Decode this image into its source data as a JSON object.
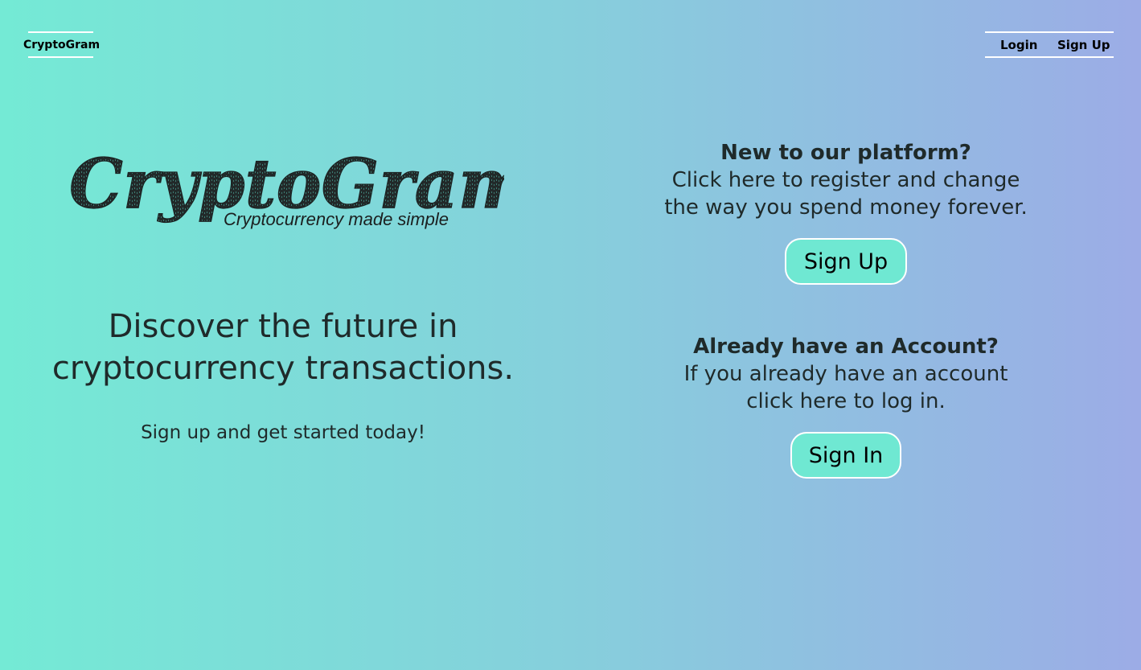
{
  "navbar": {
    "brand": "CryptoGram",
    "login_label": "Login",
    "signup_label": "Sign Up"
  },
  "logo": {
    "wordmark": "CryptoGram",
    "tagline": "Cryptocurrency made simple"
  },
  "hero": {
    "headline_line1": "Discover the future in",
    "headline_line2": "cryptocurrency transactions.",
    "subline": "Sign up and get started today!"
  },
  "register_panel": {
    "title": "New to our platform?",
    "text_line1": "Click here to register and change",
    "text_line2": "the way you spend money forever.",
    "button_label": "Sign Up"
  },
  "login_panel": {
    "title": "Already have an Account?",
    "text_line1": "If you already have an account",
    "text_line2": "click here to log in.",
    "button_label": "Sign In"
  },
  "colors": {
    "gradient_start": "#74ead5",
    "gradient_end": "#9cace6",
    "button_bg": "#6fe8d2",
    "text": "#1f2a2a"
  }
}
